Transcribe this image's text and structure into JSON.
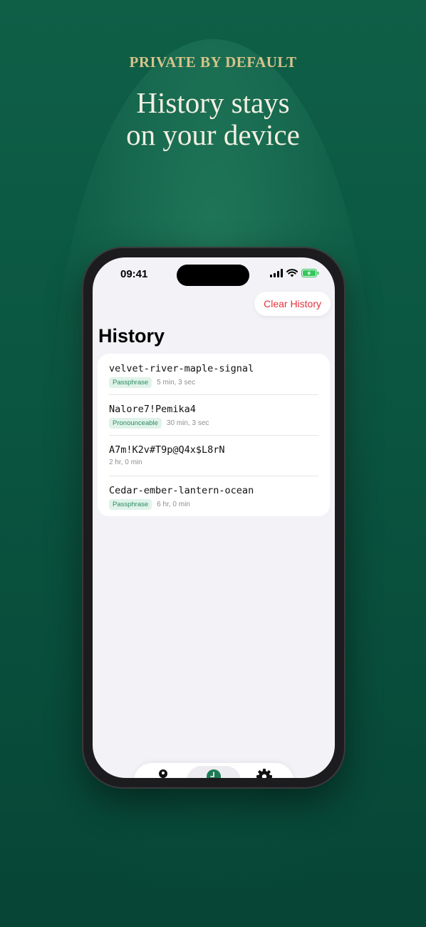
{
  "promo": {
    "eyebrow": "PRIVATE BY DEFAULT",
    "headline_line1": "History stays",
    "headline_line2": "on your device"
  },
  "status_bar": {
    "time": "09:41",
    "icons": [
      "signal-icon",
      "wifi-icon",
      "battery-charging-icon"
    ]
  },
  "toolbar": {
    "clear_label": "Clear History"
  },
  "page": {
    "title": "History"
  },
  "history": [
    {
      "value": "velvet-river-maple-signal",
      "type": "Passphrase",
      "age": "5 min, 3 sec"
    },
    {
      "value": "Nalore7!Pemika4",
      "type": "Pronounceable",
      "age": "30 min, 3 sec"
    },
    {
      "value": "A7m!K2v#T9p@Q4x$L8rN",
      "type": "",
      "age": "2 hr, 0 min"
    },
    {
      "value": "Cedar-ember-lantern-ocean",
      "type": "Passphrase",
      "age": "6 hr, 0 min"
    }
  ],
  "tab_bar": {
    "tabs": [
      {
        "icon": "key-icon",
        "active": false
      },
      {
        "icon": "clock-icon",
        "active": true
      },
      {
        "icon": "gear-icon",
        "active": false
      }
    ]
  },
  "colors": {
    "background": "#0a5540",
    "accent_gold": "#d6c38a",
    "destructive": "#e5323b",
    "tab_active": "#1e7a55",
    "badge_text": "#2f8a63",
    "badge_bg": "#dff3ea"
  }
}
